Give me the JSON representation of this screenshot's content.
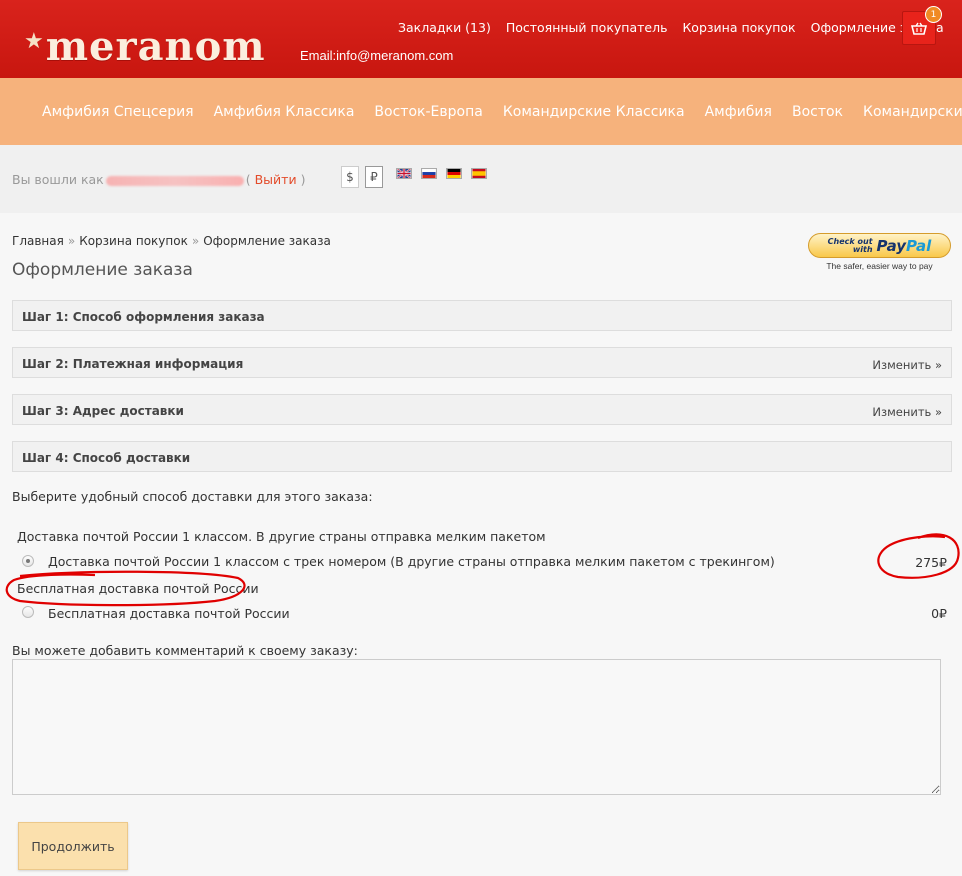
{
  "brand": {
    "logo_text": "meranom",
    "star": "★"
  },
  "top_links": [
    "Закладки (13)",
    "Постоянный покупатель",
    "Корзина покупок",
    "Оформление заказа"
  ],
  "email": "Email:info@meranom.com",
  "cart": {
    "badge": "1",
    "icon": "basket-icon"
  },
  "nav": [
    "Амфибия Спецсерия",
    "Амфибия Классика",
    "Восток-Европа",
    "Командирские Классика",
    "Амфибия",
    "Восток",
    "Командирские"
  ],
  "user": {
    "logged_prefix": "Вы вошли как",
    "logout_open": "(",
    "logout": "Выйти",
    "logout_close": ")"
  },
  "currencies": [
    "$",
    "₽"
  ],
  "languages": [
    "en",
    "ru",
    "de",
    "es"
  ],
  "breadcrumb": {
    "items": [
      "Главная",
      "Корзина покупок",
      "Оформление заказа"
    ],
    "sep": "»"
  },
  "page_title": "Оформление заказа",
  "paypal": {
    "line1": "Check out",
    "line2": "with",
    "brand_pay": "Pay",
    "brand_pal": "Pal",
    "tagline": "The safer, easier way to pay"
  },
  "steps": [
    {
      "title": "Шаг 1: Способ оформления заказа",
      "edit": ""
    },
    {
      "title": "Шаг 2: Платежная информация",
      "edit": "Изменить »"
    },
    {
      "title": "Шаг 3: Адрес доставки",
      "edit": "Изменить »"
    },
    {
      "title": "Шаг 4: Способ доставки",
      "edit": ""
    }
  ],
  "shipping": {
    "prompt": "Выберите удобный способ доставки для этого заказа:",
    "groups": [
      {
        "title": "Доставка почтой России 1 классом. В другие страны отправка мелким пакетом",
        "option": "Доставка почтой России 1 классом с трек номером (В другие страны отправка мелким пакетом с трекингом)",
        "price": "275₽",
        "selected": true
      },
      {
        "title": "Бесплатная доставка почтой России",
        "option": "Бесплатная доставка почтой России",
        "price": "0₽",
        "selected": false
      }
    ]
  },
  "comment_label": "Вы можете добавить комментарий к своему заказу:",
  "comment_value": "",
  "continue_label": "Продолжить",
  "colors": {
    "header_red": "#d9231c",
    "nav_orange": "#f6b27c",
    "button_bg": "#fbe0ad",
    "annotation_red": "#e00000"
  }
}
